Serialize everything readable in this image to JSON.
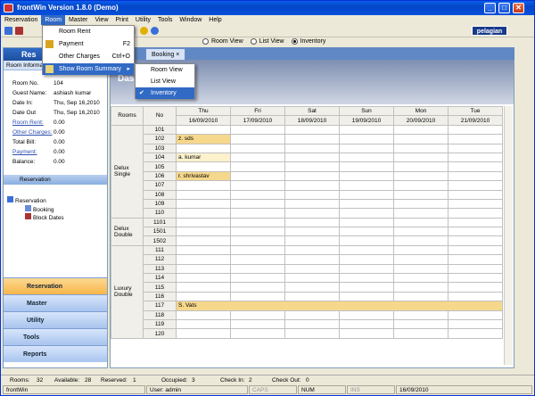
{
  "window": {
    "title": "frontWin Version 1.8.0 (Demo)",
    "min": "_",
    "max": "□",
    "close": "✕"
  },
  "menubar": [
    "Reservation",
    "Room",
    "Master",
    "View",
    "Print",
    "Utility",
    "Tools",
    "Window",
    "Help"
  ],
  "logo": "pelagian",
  "view_options": [
    {
      "label": "Room View",
      "selected": false
    },
    {
      "label": "List View",
      "selected": false
    },
    {
      "label": "Inventory",
      "selected": true
    }
  ],
  "room_menu": {
    "items": [
      {
        "label": "Room Rent",
        "shortcut": ""
      },
      {
        "label": "Payment",
        "shortcut": "F2"
      },
      {
        "label": "Other Charges",
        "shortcut": "Ctrl+O"
      },
      {
        "label": "Show Room Summary",
        "shortcut": "▸"
      }
    ]
  },
  "summary_menu": {
    "items": [
      "Room View",
      "List View",
      "Inventory"
    ],
    "checked": "✔"
  },
  "left": {
    "header": "Res",
    "subheader": "Room Informa",
    "info": [
      {
        "k": "Room No.",
        "v": "104",
        "link": false
      },
      {
        "k": "Guest Name:",
        "v": "ashiash kumar",
        "link": false
      },
      {
        "k": "Date In:",
        "v": "Thu, Sep 16,2010",
        "link": false
      },
      {
        "k": "Date Out",
        "v": "Thu, Sep 16,2010",
        "link": false
      },
      {
        "k": "Room Rent:",
        "v": "0.00",
        "link": true
      },
      {
        "k": "Other Charges:",
        "v": "0.00",
        "link": true
      },
      {
        "k": "Total Bill:",
        "v": "0.00",
        "link": false
      },
      {
        "k": "Payment:",
        "v": "0.00",
        "link": true
      },
      {
        "k": "Balance:",
        "v": "0.00",
        "link": false
      }
    ],
    "reservation_header": "Reservation",
    "tree": {
      "root": "Reservation",
      "children": [
        "Booking",
        "Block Dates"
      ]
    },
    "nav": [
      "Reservation",
      "Master",
      "Utility",
      "Tools",
      "Reports"
    ]
  },
  "tabs": {
    "active": "Booking",
    "close": "×"
  },
  "dash_title": "Das",
  "grid": {
    "headers": {
      "rooms": "Rooms",
      "no": "No"
    },
    "days": [
      {
        "d": "Thu",
        "date": "16/09/2010"
      },
      {
        "d": "Fri",
        "date": "17/09/2010"
      },
      {
        "d": "Sat",
        "date": "18/09/2010"
      },
      {
        "d": "Sun",
        "date": "19/09/2010"
      },
      {
        "d": "Mon",
        "date": "20/09/2010"
      },
      {
        "d": "Tue",
        "date": "21/09/2010"
      }
    ],
    "groups": [
      {
        "name": "Delux Single",
        "rooms": [
          "101",
          "102",
          "103",
          "104",
          "105",
          "106",
          "107",
          "108",
          "109",
          "110"
        ]
      },
      {
        "name": "Delux Double",
        "rooms": [
          "1101",
          "1501",
          "1502"
        ]
      },
      {
        "name": "Luxury Double",
        "rooms": [
          "111",
          "112",
          "113",
          "114",
          "115",
          "116",
          "117",
          "118",
          "119",
          "120"
        ]
      }
    ],
    "bookings": [
      {
        "room": "102",
        "guest": "z. sds",
        "span": 1,
        "style": "bk"
      },
      {
        "room": "104",
        "guest": "a. kumar",
        "span": 1,
        "style": "bk2"
      },
      {
        "room": "106",
        "guest": "r. shrivastav",
        "span": 1,
        "style": "bk"
      },
      {
        "room": "117",
        "guest": "S. Vats",
        "span": 6,
        "style": "bk"
      }
    ]
  },
  "status1": {
    "rooms": "Rooms:",
    "rooms_v": "32",
    "available": "Available:",
    "available_v": "28",
    "reserved": "Reserved:",
    "reserved_v": "1",
    "occupied": "Occupied:",
    "occupied_v": "3",
    "checkin": "Check In:",
    "checkin_v": "2",
    "checkout": "Check Out:",
    "checkout_v": "0"
  },
  "status2": {
    "app": "frontWin",
    "user": "User: admin",
    "caps": "CAPS",
    "num": "NUM",
    "ins": "INS",
    "date": "16/09/2010"
  }
}
